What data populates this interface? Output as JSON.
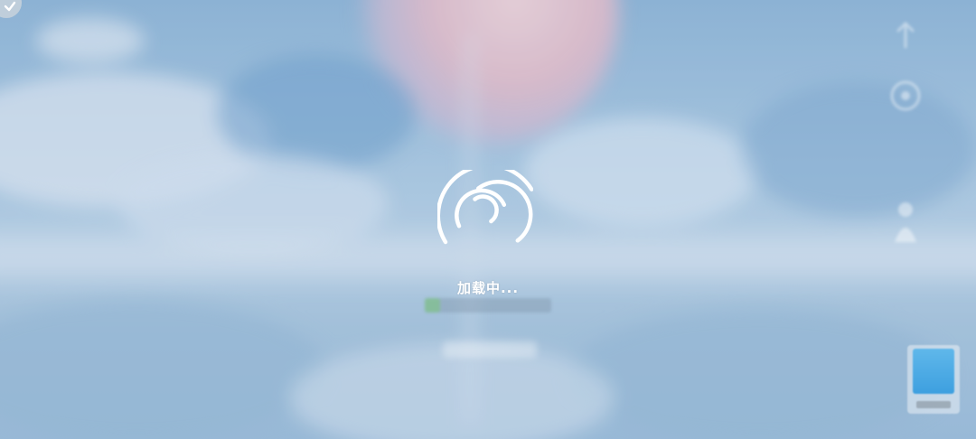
{
  "loading": {
    "text": "加载中...",
    "progress": 0.12
  },
  "icons": {
    "corner": "check-icon",
    "spinner": "loading-spinner-icon",
    "side": [
      "upload-icon",
      "settings-icon",
      "character-icon"
    ]
  },
  "colors": {
    "sky_top": "#8fb7d9",
    "sky_bottom": "#9dbfdc",
    "text": "#ffffff",
    "progress_fill": "#78c878",
    "widget_screen": "#4aa8e4"
  }
}
